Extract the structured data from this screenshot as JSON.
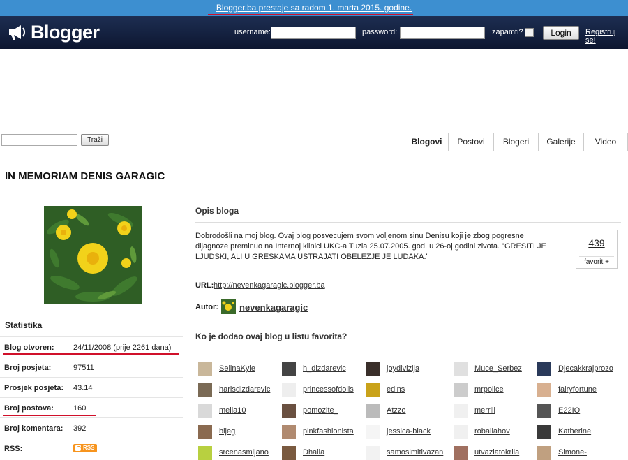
{
  "banner": {
    "text": "Blogger.ba prestaje sa radom 1. marta 2015. godine."
  },
  "header": {
    "logo_text": "Blogger",
    "username_label": "username:",
    "password_label": "password:",
    "remember_label": "zapamti?",
    "login_button": "Login",
    "register_link": "Registruj se!"
  },
  "search": {
    "button_label": "Traži"
  },
  "tabs": [
    {
      "label": "Blogovi",
      "active": true
    },
    {
      "label": "Postovi",
      "active": false
    },
    {
      "label": "Blogeri",
      "active": false
    },
    {
      "label": "Galerije",
      "active": false
    },
    {
      "label": "Video",
      "active": false
    }
  ],
  "blog": {
    "title": "IN MEMORIAM DENIS GARAGIC",
    "description_heading": "Opis bloga",
    "description": "Dobrodošli na moj blog. Ovaj blog posvecujem svom voljenom sinu Denisu koji je zbog pogresne dijagnoze preminuo na Internoj klinici UKC-a Tuzla 25.07.2005. god. u 26-oj godini zivota. \"GRESITI JE LJUDSKI, ALI U GRESKAMA USTRAJATI OBELEZJE JE LUDAKA.\"",
    "favorites_count": "439",
    "favorites_link": "favorit +",
    "url_label": "URL:",
    "url": "http://nevenkagaragic.blogger.ba",
    "author_label": "Autor:",
    "author": "nevenkagaragic"
  },
  "stats": {
    "heading": "Statistika",
    "rows": [
      {
        "label": "Blog otvoren:",
        "value": "24/11/2008 (prije 2261 dana)"
      },
      {
        "label": "Broj posjeta:",
        "value": "97511"
      },
      {
        "label": "Prosjek posjeta:",
        "value": "43.14"
      },
      {
        "label": "Broj postova:",
        "value": "160"
      },
      {
        "label": "Broj komentara:",
        "value": "392"
      },
      {
        "label": "RSS:",
        "value": "RSS"
      }
    ]
  },
  "favorites": {
    "heading": "Ko je dodao ovaj blog u listu favorita?",
    "users": [
      "SelinaKyle",
      "h_dizdarevic",
      "joydivizija",
      "Muce_Serbez",
      "Djecakkrajprozo",
      "harisdizdarevic",
      "princessofdolls",
      "edins",
      "mrpolice",
      "fairyfortune",
      "mella10",
      "pomozite_",
      "Atzzo",
      "merriii",
      "E22IO",
      "bijeg",
      "pinkfashionista",
      "jessica-black",
      "roballahov",
      "Katherine",
      "srcenasmijano",
      "Dhalia",
      "samosimitivazan",
      "utvazlatokrila",
      "Simone-"
    ]
  },
  "colors": {
    "banner": "#3d8fd0",
    "header": "#16223f",
    "highlight": "#d0102a"
  }
}
